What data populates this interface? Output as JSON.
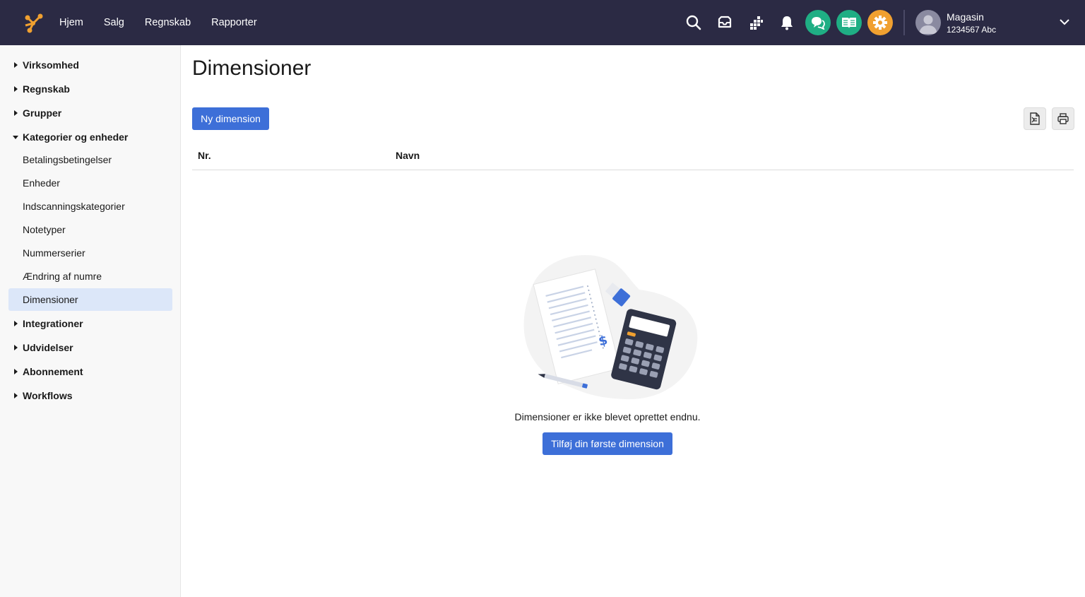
{
  "topbar": {
    "nav": [
      "Hjem",
      "Salg",
      "Regnskab",
      "Rapporter"
    ],
    "icons": [
      "search-icon",
      "inbox-icon",
      "apps-grid-icon",
      "bell-icon",
      "chat-icon",
      "book-icon",
      "gear-icon"
    ],
    "accent_colors": {
      "chat": "#1fae84",
      "book": "#1fae84",
      "gear": "#f0a030",
      "bar": "#2b2a44",
      "logo": "#f0a030"
    },
    "user": {
      "name": "Magasin",
      "sub": "1234567 Abc"
    }
  },
  "sidebar": {
    "groups": [
      {
        "label": "Virksomhed",
        "expanded": false
      },
      {
        "label": "Regnskab",
        "expanded": false
      },
      {
        "label": "Grupper",
        "expanded": false
      },
      {
        "label": "Kategorier og enheder",
        "expanded": true,
        "items": [
          "Betalingsbetingelser",
          "Enheder",
          "Indscanningskategorier",
          "Notetyper",
          "Nummerserier",
          "Ændring af numre",
          "Dimensioner"
        ]
      },
      {
        "label": "Integrationer",
        "expanded": false
      },
      {
        "label": "Udvidelser",
        "expanded": false
      },
      {
        "label": "Abonnement",
        "expanded": false
      },
      {
        "label": "Workflows",
        "expanded": false
      }
    ],
    "active_item": "Dimensioner"
  },
  "main": {
    "title": "Dimensioner",
    "new_button": "Ny dimension",
    "table": {
      "columns": [
        "Nr.",
        "Navn"
      ],
      "rows": []
    },
    "empty_state": {
      "message": "Dimensioner er ikke blevet oprettet endnu.",
      "button": "Tilføj din første dimension"
    },
    "primary_color": "#3d6fd8"
  }
}
